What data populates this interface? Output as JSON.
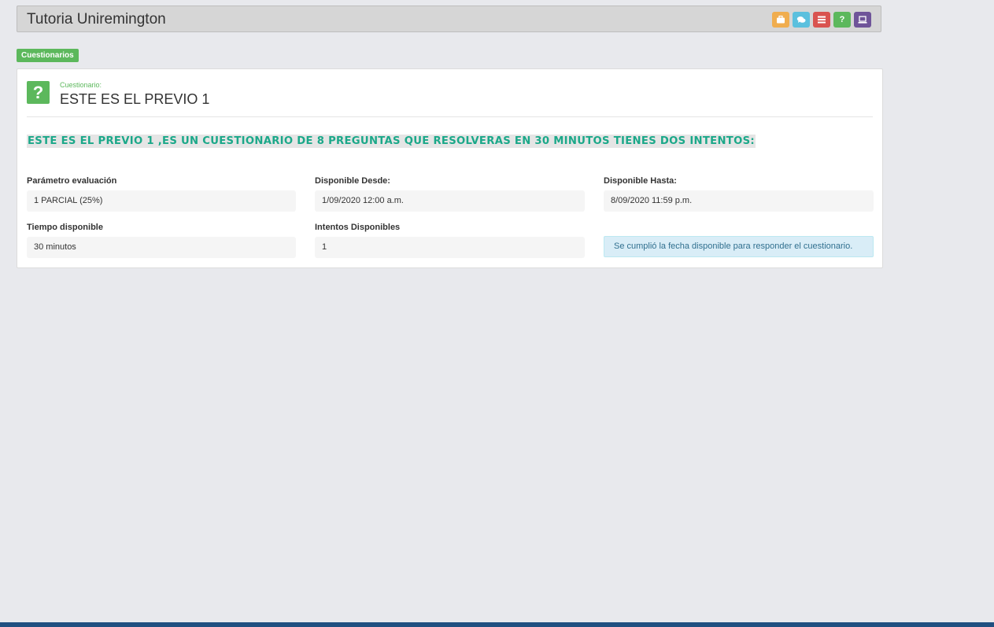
{
  "header": {
    "title": "Tutoria Uniremington",
    "icons": [
      {
        "name": "briefcase-icon",
        "color": "#f0ad4e"
      },
      {
        "name": "comments-icon",
        "color": "#5bc0de"
      },
      {
        "name": "list-icon",
        "color": "#d9534f"
      },
      {
        "name": "question-icon",
        "color": "#5cb85c",
        "glyph": "?"
      },
      {
        "name": "laptop-icon",
        "color": "#6f5499"
      }
    ]
  },
  "tag": {
    "label": "Cuestionarios"
  },
  "card": {
    "icon_glyph": "?",
    "sublabel": "Cuestionario:",
    "title": "ESTE ES EL PREVIO 1",
    "description": "ESTE ES EL PREVIO 1 ,ES UN CUESTIONARIO DE 8 PREGUNTAS QUE RESOLVERAS EN 30 MINUTOS TIENES DOS INTENTOS:",
    "fields": {
      "parametro": {
        "label": "Parámetro evaluación",
        "value": "1 PARCIAL (25%)"
      },
      "desde": {
        "label": "Disponible Desde:",
        "value": "1/09/2020 12:00 a.m."
      },
      "hasta": {
        "label": "Disponible Hasta:",
        "value": "8/09/2020 11:59 p.m."
      },
      "tiempo": {
        "label": "Tiempo disponible",
        "value": "30 minutos"
      },
      "intentos": {
        "label": "Intentos Disponibles",
        "value": "1"
      }
    },
    "alert": "Se cumplió la fecha disponible para responder el cuestionario."
  }
}
